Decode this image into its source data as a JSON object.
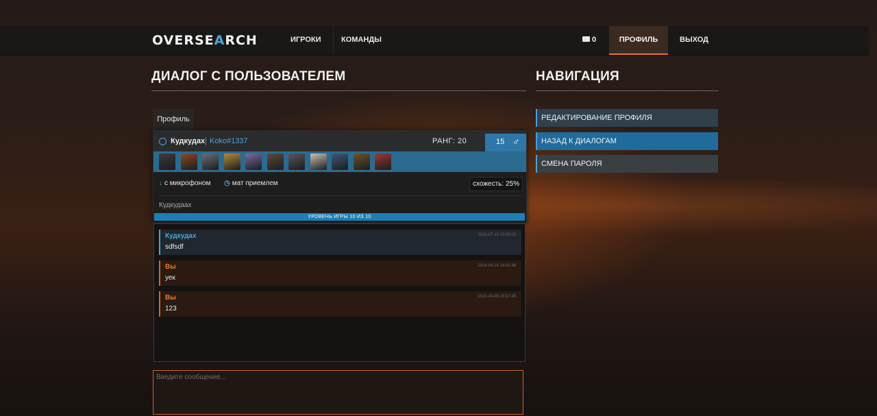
{
  "nav": {
    "logo_a": "OVERSE",
    "logo_b": "A",
    "logo_c": "RCH",
    "players": "ИГРОКИ",
    "teams": "КОМАНДЫ",
    "messages_count": "0",
    "profile": "ПРОФИЛЬ",
    "logout": "ВЫХОД"
  },
  "page": {
    "title": "ДИАЛОГ С ПОЛЬЗОВАТЕЛЕМ"
  },
  "profile_card": {
    "tab_label": "Профиль",
    "username": "Кудкудах",
    "battletag": "Koko#1337",
    "rank": "РАНГ: 20",
    "age": "15",
    "gender_symbol": "♂",
    "hero_colors": [
      "#3b3b42",
      "#8b4a2b",
      "#6b6f78",
      "#b38b3a",
      "#7a6aa8",
      "#5a4a3c",
      "#55575e",
      "#c7c2b5",
      "#3c5a78",
      "#6a5430",
      "#9a3a3a"
    ],
    "features": {
      "mic": "с микрофоном",
      "swear": "мат приемлем"
    },
    "similarity": "схожесть: 25%",
    "description": "Кудкудаах",
    "level": "УРОВЕНЬ ИГРЫ 10 ИЗ 10"
  },
  "messages": [
    {
      "author": "Кудкудах",
      "text": "sdfsdf",
      "time": "2016-07-10 13:08:02",
      "side": "them"
    },
    {
      "author": "Вы",
      "text": "уек",
      "time": "2018-04-14 14:41:46",
      "side": "me"
    },
    {
      "author": "Вы",
      "text": "123",
      "time": "2022-04-08 15:57:45",
      "side": "me"
    }
  ],
  "compose": {
    "placeholder": "Введите сообщение..."
  },
  "sidebar": {
    "title": "НАВИГАЦИЯ",
    "items": [
      {
        "label": "Редактирование профиля",
        "bg": "#30404c"
      },
      {
        "label": "Назад к диалогам",
        "bg": "#1f6c9c"
      },
      {
        "label": "Смена пароля",
        "bg": "#3a3f44"
      }
    ]
  }
}
